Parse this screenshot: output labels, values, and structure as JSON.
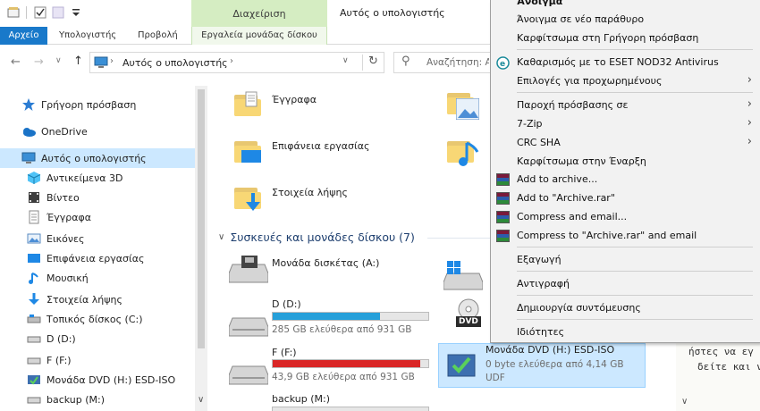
{
  "window": {
    "title": "Αυτός ο υπολογιστής",
    "manage_tab": "Διαχείριση"
  },
  "ribbon": {
    "tabs": [
      {
        "label": "Αρχείο"
      },
      {
        "label": "Υπολογιστής"
      },
      {
        "label": "Προβολή"
      },
      {
        "label": "Εργαλεία μονάδας δίσκου"
      }
    ]
  },
  "address": {
    "path": "Αυτός ο υπολογιστής",
    "search_placeholder": "Αναζήτηση: Α"
  },
  "nav": {
    "items": [
      {
        "label": "Γρήγορη πρόσβαση",
        "icon": "star-icon"
      },
      {
        "label": "OneDrive",
        "icon": "cloud-icon"
      },
      {
        "label": "Αυτός ο υπολογιστής",
        "icon": "computer-icon"
      },
      {
        "label": "Αντικείμενα 3D",
        "icon": "cube-icon"
      },
      {
        "label": "Βίντεο",
        "icon": "video-icon"
      },
      {
        "label": "Έγγραφα",
        "icon": "document-icon"
      },
      {
        "label": "Εικόνες",
        "icon": "pictures-icon"
      },
      {
        "label": "Επιφάνεια εργασίας",
        "icon": "desktop-icon"
      },
      {
        "label": "Μουσική",
        "icon": "music-icon"
      },
      {
        "label": "Στοιχεία λήψης",
        "icon": "download-icon"
      },
      {
        "label": "Τοπικός δίσκος (C:)",
        "icon": "drive-icon"
      },
      {
        "label": "D (D:)",
        "icon": "drive-icon"
      },
      {
        "label": "F (F:)",
        "icon": "drive-icon"
      },
      {
        "label": "Μονάδα DVD (H:) ESD-ISO",
        "icon": "dvd-icon"
      },
      {
        "label": "backup (M:)",
        "icon": "drive-icon"
      }
    ]
  },
  "folders": [
    {
      "label": "Έγγραφα"
    },
    {
      "label": "Επιφάνεια εργασίας"
    },
    {
      "label": "Στοιχεία λήψης"
    }
  ],
  "devices": {
    "heading": "Συσκευές και μονάδες δίσκου (7)",
    "items": [
      {
        "name": "Μονάδα δισκέτας (A:)"
      },
      {
        "name": "D (D:)",
        "free": "285 GB ελεύθερα από 931 GB",
        "usage": 0.69,
        "bar_color": "#26a0da"
      },
      {
        "name": "F (F:)",
        "free": "43,9 GB ελεύθερα από 931 GB",
        "usage": 0.95,
        "bar_color": "#da2626"
      },
      {
        "name": "backup (M:)"
      },
      {
        "name": "Μονάδα DVD (H:) ESD-ISO",
        "free": "0 byte ελεύθερα από 4,14 GB",
        "fs": "UDF"
      }
    ],
    "dvd_label": "DVD"
  },
  "context_menu": {
    "items": [
      {
        "label": "Άνοιγμα"
      },
      {
        "label": "Άνοιγμα σε νέο παράθυρο"
      },
      {
        "label": "Καρφίτσωμα στη Γρήγορη πρόσβαση"
      },
      {
        "label": "Καθαρισμός με το ESET NOD32 Antivirus"
      },
      {
        "label": "Επιλογές για προχωρημένους"
      },
      {
        "label": "Παροχή πρόσβασης σε"
      },
      {
        "label": "7-Zip"
      },
      {
        "label": "CRC SHA"
      },
      {
        "label": "Καρφίτσωμα στην Έναρξη"
      },
      {
        "label": "Add to archive..."
      },
      {
        "label": "Add to \"Archive.rar\""
      },
      {
        "label": "Compress and email..."
      },
      {
        "label": "Compress to \"Archive.rar\" and email"
      },
      {
        "label": "Εξαγωγή"
      },
      {
        "label": "Αντιγραφή"
      },
      {
        "label": "Δημιουργία συντόμευσης"
      },
      {
        "label": "Ιδιότητες"
      }
    ]
  },
  "background_text": {
    "line1": "ήστες να εγ",
    "line2": "δείτε και ν"
  }
}
